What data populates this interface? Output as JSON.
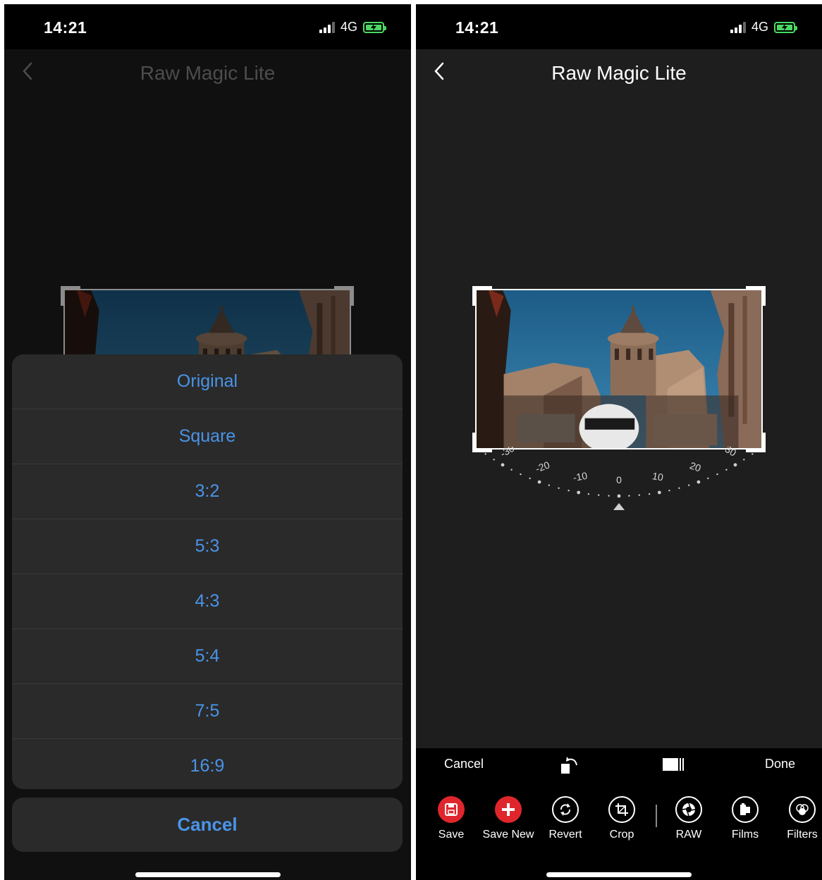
{
  "left_screen": {
    "status": {
      "time": "14:21",
      "network": "4G"
    },
    "title": "Raw Magic Lite",
    "aspect_options": [
      "Original",
      "Square",
      "3:2",
      "5:3",
      "4:3",
      "5:4",
      "7:5",
      "16:9"
    ],
    "cancel_label": "Cancel"
  },
  "right_screen": {
    "status": {
      "time": "14:21",
      "network": "4G"
    },
    "title": "Raw Magic Lite",
    "rotation_dial": {
      "ticks": [
        "-30",
        "-20",
        "-10",
        "0",
        "10",
        "20",
        "30"
      ],
      "value": 0
    },
    "crop_toolbar": {
      "cancel": "Cancel",
      "done": "Done"
    },
    "tools": {
      "save": "Save",
      "save_new": "Save New",
      "revert": "Revert",
      "crop": "Crop",
      "raw": "RAW",
      "films": "Films",
      "filters": "Filters"
    }
  },
  "colors": {
    "accent_blue": "#4a94e8",
    "save_red": "#e0262d",
    "battery_green": "#4bd964"
  }
}
